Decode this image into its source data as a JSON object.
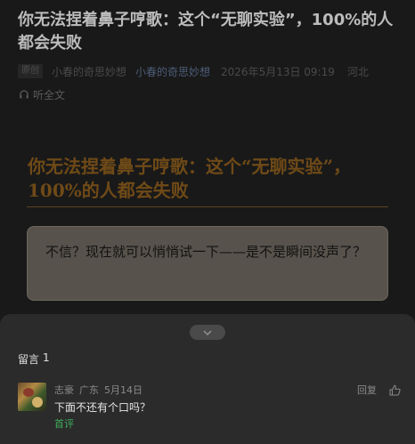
{
  "article": {
    "title": "你无法捏着鼻子哼歌：这个“无聊实验”，100%的人都会失败",
    "meta": {
      "badge": "原创",
      "author_a": "小春的奇思妙想",
      "author_b": "小春的奇思妙想",
      "date": "2026年5月13日 09:19",
      "location": "河北"
    },
    "listen_label": "听全文",
    "headline": "你无法捏着鼻子哼歌：这个“无聊实验”，100%的人都会失败",
    "quote": "不信？现在就可以悄悄试一下——是不是瞬间没声了？"
  },
  "comments_sheet": {
    "title": "留言",
    "count": "1",
    "comments": [
      {
        "author": "志豪",
        "location": "广东",
        "date": "5月14日",
        "reply_label": "回复",
        "text": "下面不还有个口吗？",
        "tag": "首评"
      }
    ]
  },
  "colors": {
    "background": "#191919",
    "headline": "#6f4a17",
    "first_comment_tag": "#3fae5b",
    "sheet": "#2b2b2b"
  }
}
